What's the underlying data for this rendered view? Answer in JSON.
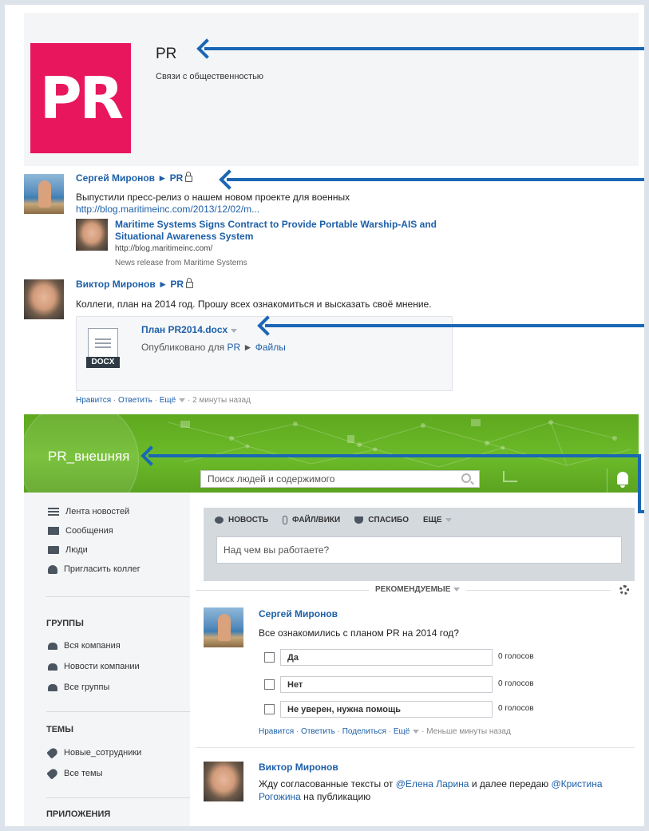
{
  "group": {
    "logo_text": "PR",
    "title": "PR",
    "subtitle": "Связи с общественностью"
  },
  "post1": {
    "author": "Сергей Миронов",
    "separator": "►",
    "group": "PR",
    "text": "Выпустили пресс-релиз о нашем новом проекте для военных",
    "link": "http://blog.maritimeinc.com/2013/12/02/m...",
    "share_title": "Maritime Systems Signs Contract to Provide Portable Warship-AIS and Situational Awareness System",
    "share_url": "http://blog.maritimeinc.com/",
    "share_source": "News release from Maritime Systems"
  },
  "post2": {
    "author": "Виктор Миронов",
    "separator": "►",
    "group": "PR",
    "text": "Коллеги, план на 2014 год. Прошу всех ознакомиться и высказать своё мнение.",
    "file_name": "План PR2014.docx",
    "file_type": "DOCX",
    "published_prefix": "Опубликовано для",
    "published_group": "PR",
    "published_sep": "►",
    "published_folder": "Файлы",
    "actions": {
      "like": "Нравится",
      "reply": "Ответить",
      "more": "Ещё",
      "time": "2 минуты назад",
      "dot": "·"
    }
  },
  "network": {
    "name": "PR_внешняя",
    "search_placeholder": "Поиск людей и содержимого"
  },
  "sidebar": {
    "nav": [
      {
        "label": "Лента новостей",
        "icon": "feed-icon"
      },
      {
        "label": "Сообщения",
        "icon": "mail-icon"
      },
      {
        "label": "Люди",
        "icon": "people-icon"
      },
      {
        "label": "Пригласить коллег",
        "icon": "invite-icon"
      }
    ],
    "groups_title": "ГРУППЫ",
    "groups": [
      {
        "label": "Вся компания",
        "icon": "group-icon"
      },
      {
        "label": "Новости компании",
        "icon": "group-icon"
      },
      {
        "label": "Все группы",
        "icon": "group-icon"
      }
    ],
    "topics_title": "ТЕМЫ",
    "topics": [
      {
        "label": "Новые_сотрудники",
        "icon": "tag-icon"
      },
      {
        "label": "Все темы",
        "icon": "tag-icon"
      }
    ],
    "apps_title": "ПРИЛОЖЕНИЯ"
  },
  "publisher": {
    "tabs": [
      "НОВОСТЬ",
      "ФАЙЛ/ВИКИ",
      "СПАСИБО",
      "ЕЩЕ"
    ],
    "placeholder": "Над чем вы работаете?"
  },
  "feed": {
    "filter": "РЕКОМЕНДУЕМЫЕ"
  },
  "poll_post": {
    "author": "Сергей Миронов",
    "question": "Все ознакомились с планом PR на 2014 год?",
    "options": [
      {
        "label": "Да",
        "votes": "0 голосов"
      },
      {
        "label": "Нет",
        "votes": "0 голосов"
      },
      {
        "label": "Не уверен, нужна помощь",
        "votes": "0 голосов"
      }
    ],
    "actions": {
      "like": "Нравится",
      "reply": "Ответить",
      "share": "Поделиться",
      "more": "Ещё",
      "time": "Меньше минуты назад",
      "dot": "·"
    }
  },
  "last_post": {
    "author": "Виктор Миронов",
    "text_1": "Жду согласованные тексты от ",
    "mention_1": "@Елена Ларина",
    "text_2": " и далее передаю ",
    "mention_2a": "@Кристина",
    "mention_2b": "Рогожина",
    "text_3": " на публикацию"
  },
  "colors": {
    "brand_pink": "#e8175d",
    "link_blue": "#1d5fa8",
    "network_green": "#6cbb2a",
    "arrow_blue": "#1a67b5"
  }
}
